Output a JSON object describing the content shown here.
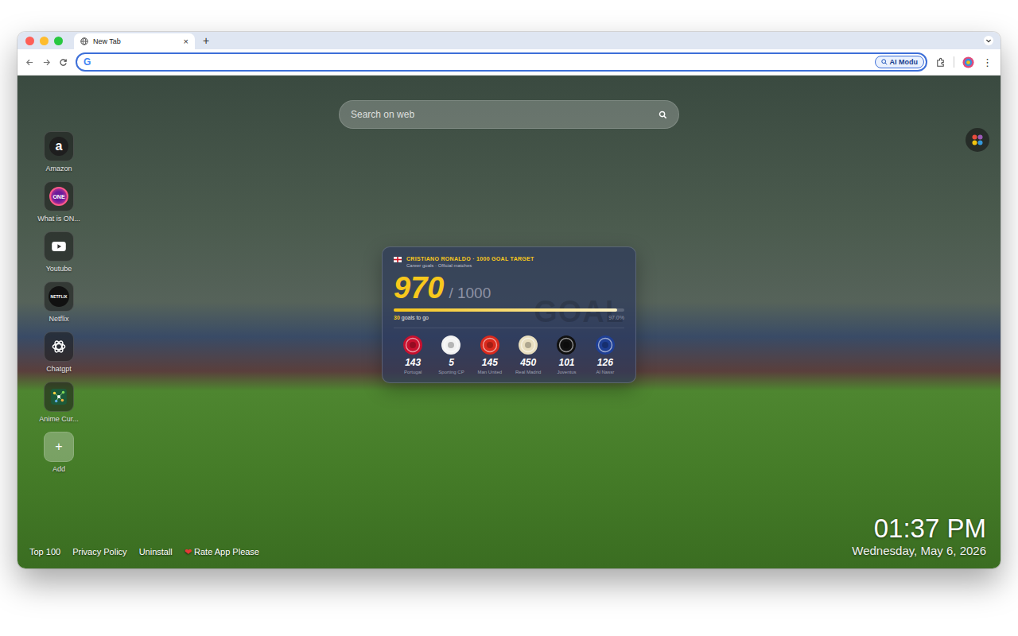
{
  "browser": {
    "tabs": [
      {
        "title": "New Tab",
        "close": "×",
        "selected": true
      }
    ],
    "new_tab": "+",
    "address_bar": {
      "logo": "G",
      "focused": true
    },
    "ai_button": "AI Modu",
    "menu": "⋮"
  },
  "search": {
    "placeholder": "Search on web"
  },
  "shortcuts": [
    {
      "label": "Amazon",
      "kind": "letter",
      "glyph": "a"
    },
    {
      "label": "What is ON...",
      "kind": "badge",
      "glyph": "ONE"
    },
    {
      "label": "Youtube",
      "kind": "play",
      "glyph": ""
    },
    {
      "label": "Netflix",
      "kind": "wordmark",
      "glyph": "NETFLIX"
    },
    {
      "label": "Chatgpt",
      "kind": "knot",
      "glyph": ""
    },
    {
      "label": "Anime Cur...",
      "kind": "graph",
      "glyph": ""
    },
    {
      "label": "Add",
      "kind": "add",
      "glyph": "+"
    }
  ],
  "goal_widget": {
    "title": "CRISTIANO RONALDO · 1000 GOAL TARGET",
    "subtitle": "Career goals · Official matches",
    "goals": "970",
    "target": "/ 1000",
    "level": 0.97,
    "remaining": "30",
    "remaining_label": "goals to go",
    "percent": "97.0%",
    "watermark": "GOAL",
    "clubs": [
      {
        "name": "Portugal",
        "goals": "143",
        "color": "#c8102e"
      },
      {
        "name": "Sporting CP",
        "goals": "5",
        "color": "#f2f2f2"
      },
      {
        "name": "Man United",
        "goals": "145",
        "color": "#da291c"
      },
      {
        "name": "Real Madrid",
        "goals": "450",
        "color": "#e9dfbf"
      },
      {
        "name": "Juventus",
        "goals": "101",
        "color": "#111111"
      },
      {
        "name": "Al Nassr",
        "goals": "126",
        "color": "#1f3f94"
      }
    ]
  },
  "footer_links": [
    {
      "label": "Top 100",
      "icon": ""
    },
    {
      "label": "Privacy Policy",
      "icon": ""
    },
    {
      "label": "Uninstall",
      "icon": ""
    },
    {
      "label": "Rate App Please",
      "icon": "❤"
    }
  ],
  "clock": {
    "time": "01:37 PM",
    "date": "Wednesday, May 6, 2026"
  }
}
